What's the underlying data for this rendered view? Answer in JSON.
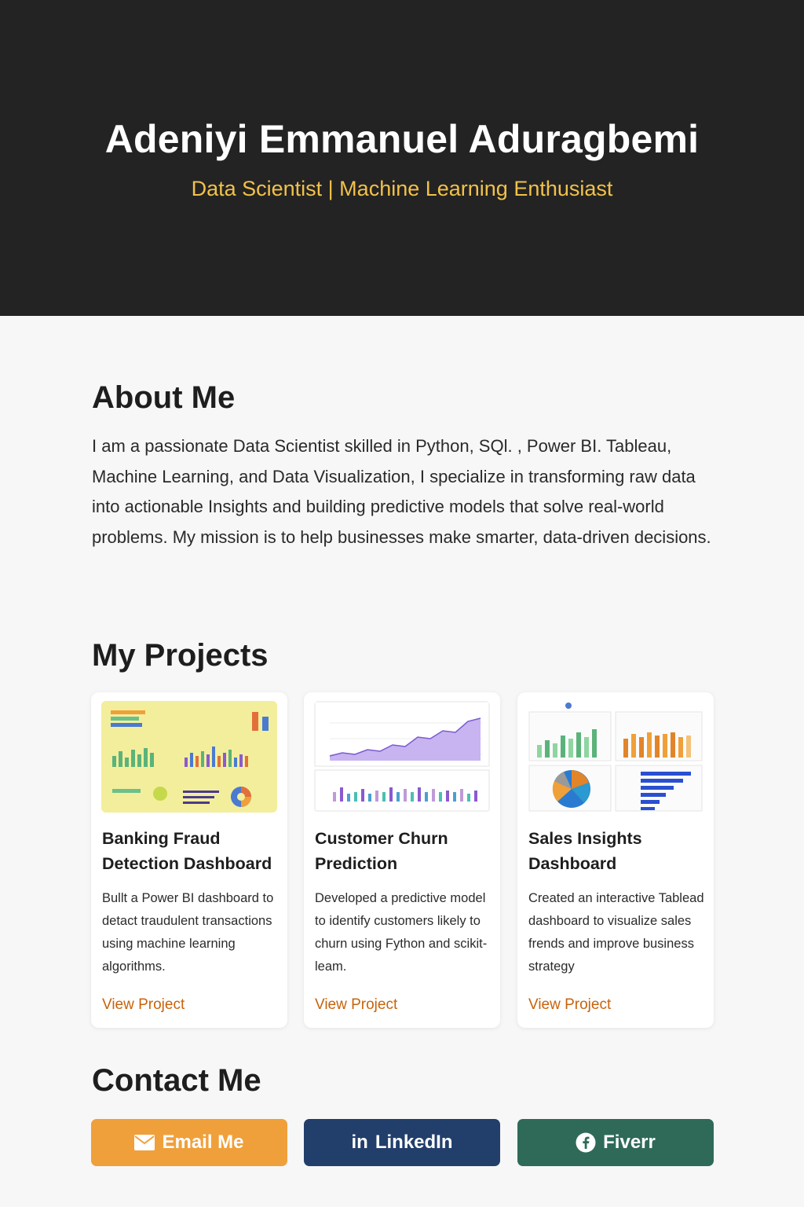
{
  "hero": {
    "name": "Adeniyi Emmanuel Aduragbemi",
    "role": "Data Scientist | Machine Learning Enthusiast"
  },
  "about": {
    "title": "About Me",
    "text": "I am a passionate Data Scientist skilled in Python, SQl. , Power BI. Tableau, Machine Learning, and Data Visualization, I specialize in transforming raw data into actionable Insights and building predictive models that solve real-world problems. My mission is to help businesses make smarter, data-driven decisions."
  },
  "projects": {
    "title": "My Projects",
    "items": [
      {
        "title": "Banking Fraud Detection Dashboard",
        "description": "Bullt a Power BI dashboard to detact traudulent transactions using machine learning algorithms.",
        "link": "View Project"
      },
      {
        "title": "Customer Churn Prediction",
        "description": "Developed a predictive model to identify customers likely to churn using Fython and scikit-leam.",
        "link": "View Project"
      },
      {
        "title": "Sales Insights Dashboard",
        "description": "Created an interactive Tablead dashboard to visualize sales frends and improve business strategy",
        "link": "View Project"
      }
    ]
  },
  "contact": {
    "title": "Contact Me",
    "email_label": "Email Me",
    "linkedin_label": "LinkedIn",
    "linkedin_icon_text": "in",
    "fiverr_label": "Fiverr"
  },
  "colors": {
    "hero_bg": "#232323",
    "accent_yellow": "#f2c14a",
    "link_orange": "#c8630a",
    "email_button": "#f0a03a",
    "linkedin_button": "#223f6b",
    "fiverr_button": "#2f6a58"
  },
  "icons": {
    "email": "envelope-icon",
    "linkedin": "linkedin-icon",
    "fiverr": "fiverr-icon"
  }
}
